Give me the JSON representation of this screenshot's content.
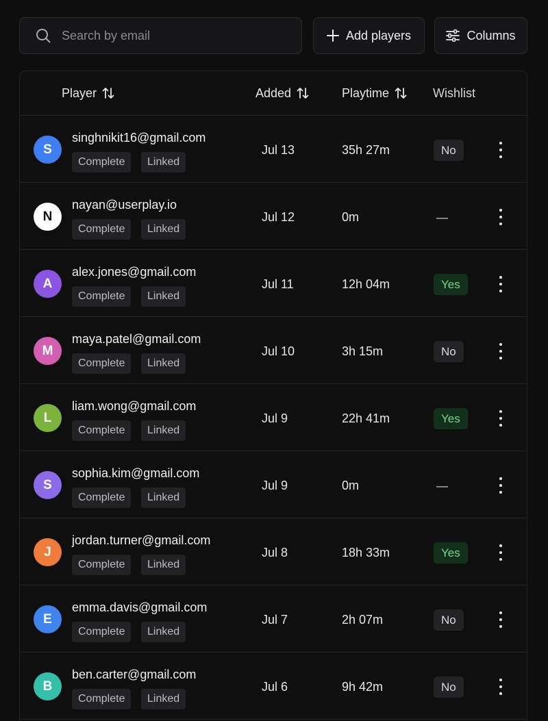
{
  "search": {
    "placeholder": "Search by email",
    "icon": "search-icon"
  },
  "toolbar": {
    "add_label": "Add players",
    "columns_label": "Columns"
  },
  "table": {
    "columns": {
      "player": "Player",
      "added": "Added",
      "playtime": "Playtime",
      "wishlist": "Wishlist"
    },
    "rows": [
      {
        "initial": "S",
        "color": "#3f7ef0",
        "email": "singhnikit16@gmail.com",
        "status": "Complete",
        "link": "Linked",
        "added": "Jul 13",
        "playtime": "35h 27m",
        "wishlist": "No"
      },
      {
        "initial": "N",
        "color": "#ffffff",
        "email": "nayan@userplay.io",
        "status": "Complete",
        "link": "Linked",
        "added": "Jul 12",
        "playtime": "0m",
        "wishlist": "—"
      },
      {
        "initial": "A",
        "color": "#8a55e0",
        "email": "alex.jones@gmail.com",
        "status": "Complete",
        "link": "Linked",
        "added": "Jul 11",
        "playtime": "12h 04m",
        "wishlist": "Yes"
      },
      {
        "initial": "M",
        "color": "#d35fb0",
        "email": "maya.patel@gmail.com",
        "status": "Complete",
        "link": "Linked",
        "added": "Jul 10",
        "playtime": "3h 15m",
        "wishlist": "No"
      },
      {
        "initial": "L",
        "color": "#7bb33d",
        "email": "liam.wong@gmail.com",
        "status": "Complete",
        "link": "Linked",
        "added": "Jul 9",
        "playtime": "22h 41m",
        "wishlist": "Yes"
      },
      {
        "initial": "S",
        "color": "#8c6be8",
        "email": "sophia.kim@gmail.com",
        "status": "Complete",
        "link": "Linked",
        "added": "Jul 9",
        "playtime": "0m",
        "wishlist": "—"
      },
      {
        "initial": "J",
        "color": "#ee7c3a",
        "email": "jordan.turner@gmail.com",
        "status": "Complete",
        "link": "Linked",
        "added": "Jul 8",
        "playtime": "18h 33m",
        "wishlist": "Yes"
      },
      {
        "initial": "E",
        "color": "#3f83ec",
        "email": "emma.davis@gmail.com",
        "status": "Complete",
        "link": "Linked",
        "added": "Jul 7",
        "playtime": "2h 07m",
        "wishlist": "No"
      },
      {
        "initial": "B",
        "color": "#33bfaa",
        "email": "ben.carter@gmail.com",
        "status": "Complete",
        "link": "Linked",
        "added": "Jul 6",
        "playtime": "9h 42m",
        "wishlist": "No"
      }
    ]
  }
}
